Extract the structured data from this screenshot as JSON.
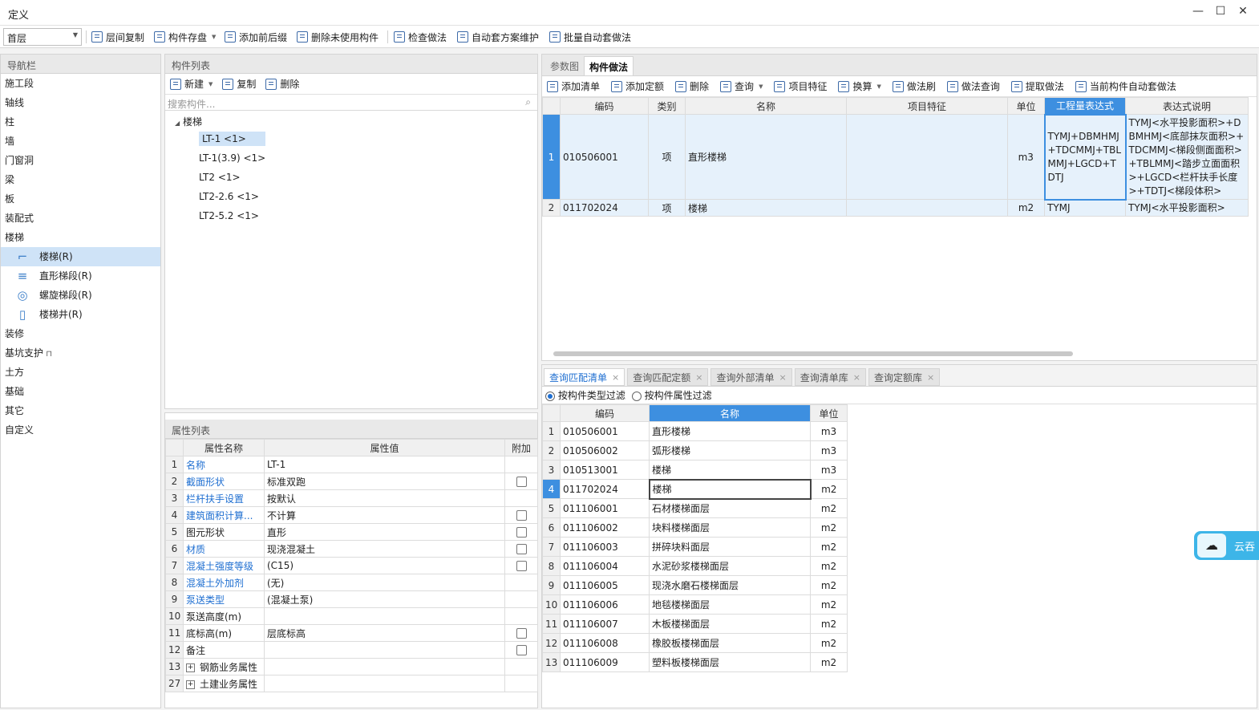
{
  "window": {
    "title": "定义"
  },
  "toolbar": {
    "floor": "首层",
    "buttons": [
      {
        "label": "层间复制"
      },
      {
        "label": "构件存盘"
      },
      {
        "label": "添加前后缀"
      },
      {
        "label": "删除未使用构件"
      },
      {
        "label": "检查做法"
      },
      {
        "label": "自动套方案维护"
      },
      {
        "label": "批量自动套做法"
      }
    ]
  },
  "nav": {
    "header": "导航栏",
    "items": [
      "施工段",
      "轴线",
      "柱",
      "墙",
      "门窗洞",
      "梁",
      "板",
      "装配式",
      "楼梯"
    ],
    "sub_items": [
      "楼梯(R)",
      "直形梯段(R)",
      "螺旋梯段(R)",
      "楼梯井(R)"
    ],
    "items_after": [
      "装修",
      "基坑支护",
      "土方",
      "基础",
      "其它",
      "自定义"
    ]
  },
  "component_list": {
    "header": "构件列表",
    "new_label": "新建",
    "copy_label": "复制",
    "delete_label": "删除",
    "search_placeholder": "搜索构件...",
    "tree_root": "楼梯",
    "items": [
      "LT-1 <1>",
      "LT-1(3.9) <1>",
      "LT2 <1>",
      "LT2-2.6 <1>",
      "LT2-5.2 <1>"
    ]
  },
  "properties": {
    "header": "属性列表",
    "columns": [
      "属性名称",
      "属性值",
      "附加"
    ],
    "rows": [
      {
        "n": "1",
        "name": "名称",
        "value": "LT-1",
        "link": true,
        "check": false
      },
      {
        "n": "2",
        "name": "截面形状",
        "value": "标准双跑",
        "link": true,
        "check": true
      },
      {
        "n": "3",
        "name": "栏杆扶手设置",
        "value": "按默认",
        "link": true,
        "check": false
      },
      {
        "n": "4",
        "name": "建筑面积计算...",
        "value": "不计算",
        "link": true,
        "check": true
      },
      {
        "n": "5",
        "name": "图元形状",
        "value": "直形",
        "link": false,
        "check": true
      },
      {
        "n": "6",
        "name": "材质",
        "value": "现浇混凝土",
        "link": true,
        "check": true
      },
      {
        "n": "7",
        "name": "混凝土强度等级",
        "value": "(C15)",
        "link": true,
        "check": true
      },
      {
        "n": "8",
        "name": "混凝土外加剂",
        "value": "(无)",
        "link": true,
        "check": false
      },
      {
        "n": "9",
        "name": "泵送类型",
        "value": "(混凝土泵)",
        "link": true,
        "check": false
      },
      {
        "n": "10",
        "name": "泵送高度(m)",
        "value": "",
        "link": false,
        "check": false
      },
      {
        "n": "11",
        "name": "底标高(m)",
        "value": "层底标高",
        "link": false,
        "check": true
      },
      {
        "n": "12",
        "name": "备注",
        "value": "",
        "link": false,
        "check": true
      },
      {
        "n": "13",
        "name": "钢筋业务属性",
        "value": "",
        "link": false,
        "check": false,
        "expand": true
      },
      {
        "n": "27",
        "name": "土建业务属性",
        "value": "",
        "link": false,
        "check": false,
        "expand": true
      }
    ]
  },
  "method": {
    "tabs": [
      "参数图",
      "构件做法"
    ],
    "toolbar": [
      "添加清单",
      "添加定额",
      "删除",
      "查询",
      "项目特征",
      "换算",
      "做法刷",
      "做法查询",
      "提取做法",
      "当前构件自动套做法"
    ],
    "columns": [
      "编码",
      "类别",
      "名称",
      "项目特征",
      "单位",
      "工程量表达式",
      "表达式说明"
    ],
    "rows": [
      {
        "n": "1",
        "code": "010506001",
        "type": "项",
        "name": "直形楼梯",
        "feature": "",
        "unit": "m3",
        "expr": "TYMJ+DBMHMJ+TDCMMJ+TBLMMJ+LGCD+TDTJ",
        "desc": "TYMJ<水平投影面积>+DBMHMJ<底部抹灰面积>+TDCMMJ<梯段侧面面积>+TBLMMJ<踏步立面面积>+LGCD<栏杆扶手长度>+TDTJ<梯段体积>"
      },
      {
        "n": "2",
        "code": "011702024",
        "type": "项",
        "name": "楼梯",
        "feature": "",
        "unit": "m2",
        "expr": "TYMJ",
        "desc": "TYMJ<水平投影面积>"
      }
    ]
  },
  "query": {
    "tabs": [
      "查询匹配清单",
      "查询匹配定额",
      "查询外部清单",
      "查询清单库",
      "查询定额库"
    ],
    "filter_type": "按构件类型过滤",
    "filter_attr": "按构件属性过滤",
    "columns": [
      "编码",
      "名称",
      "单位"
    ],
    "rows": [
      {
        "n": "1",
        "code": "010506001",
        "name": "直形楼梯",
        "unit": "m3"
      },
      {
        "n": "2",
        "code": "010506002",
        "name": "弧形楼梯",
        "unit": "m3"
      },
      {
        "n": "3",
        "code": "010513001",
        "name": "楼梯",
        "unit": "m3"
      },
      {
        "n": "4",
        "code": "011702024",
        "name": "楼梯",
        "unit": "m2"
      },
      {
        "n": "5",
        "code": "011106001",
        "name": "石材楼梯面层",
        "unit": "m2"
      },
      {
        "n": "6",
        "code": "011106002",
        "name": "块料楼梯面层",
        "unit": "m2"
      },
      {
        "n": "7",
        "code": "011106003",
        "name": "拼碎块料面层",
        "unit": "m2"
      },
      {
        "n": "8",
        "code": "011106004",
        "name": "水泥砂浆楼梯面层",
        "unit": "m2"
      },
      {
        "n": "9",
        "code": "011106005",
        "name": "现浇水磨石楼梯面层",
        "unit": "m2"
      },
      {
        "n": "10",
        "code": "011106006",
        "name": "地毯楼梯面层",
        "unit": "m2"
      },
      {
        "n": "11",
        "code": "011106007",
        "name": "木板楼梯面层",
        "unit": "m2"
      },
      {
        "n": "12",
        "code": "011106008",
        "name": "橡胶板楼梯面层",
        "unit": "m2"
      },
      {
        "n": "13",
        "code": "011106009",
        "name": "塑料板楼梯面层",
        "unit": "m2"
      }
    ]
  },
  "cloud": {
    "label": "云吞"
  },
  "colors": {
    "accent": "#3d8fe0",
    "selection": "#cfe3f7",
    "link": "#1f6fd1"
  }
}
